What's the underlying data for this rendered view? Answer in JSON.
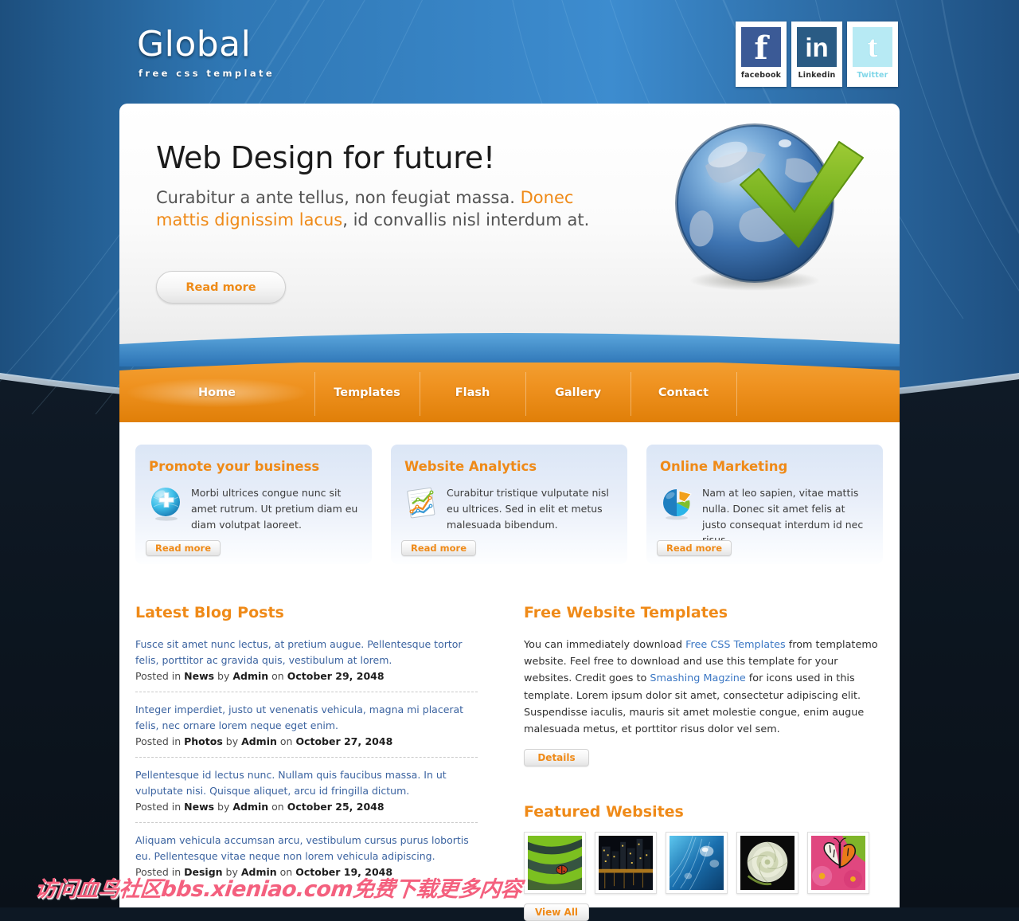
{
  "header": {
    "logo_title": "Global",
    "logo_tagline": "free css template",
    "social": [
      {
        "name": "facebook",
        "caption": "facebook",
        "glyph": "f",
        "bg": "#3b5a96"
      },
      {
        "name": "linkedin",
        "caption": "Linkedin",
        "glyph": "in",
        "bg": "#2a5b84"
      },
      {
        "name": "twitter",
        "caption": "Twitter",
        "glyph": "t",
        "bg": "#b7eaf4"
      }
    ]
  },
  "hero": {
    "title": "Web Design for future!",
    "sub_before": "Curabitur a ante tellus, non feugiat massa. ",
    "sub_highlight": "Donec mattis dignissim lacus",
    "sub_after": ", id convallis nisl interdum at.",
    "button": "Read more",
    "image": "globe-checkmark-icon"
  },
  "nav": {
    "items": [
      {
        "label": "Home",
        "active": true
      },
      {
        "label": "Templates",
        "active": false
      },
      {
        "label": "Flash",
        "active": false
      },
      {
        "label": "Gallery",
        "active": false
      },
      {
        "label": "Contact",
        "active": false
      }
    ]
  },
  "features": [
    {
      "title": "Promote your business",
      "text": "Morbi ultrices congue nunc sit amet rutrum. Ut pretium diam eu diam volutpat laoreet.",
      "button": "Read more",
      "icon": "globe-plus-icon"
    },
    {
      "title": "Website Analytics",
      "text": "Curabitur tristique vulputate nisl eu ultrices. Sed in elit et metus malesuada bibendum.",
      "button": "Read more",
      "icon": "line-chart-icon"
    },
    {
      "title": "Online Marketing",
      "text": "Nam at leo sapien, vitae mattis nulla. Donec sit amet felis at justo consequat interdum id nec risus.",
      "button": "Read more",
      "icon": "pie-chart-icon"
    }
  ],
  "blog": {
    "title": "Latest Blog Posts",
    "posts": [
      {
        "text": "Fusce sit amet nunc lectus, at pretium augue. Pellentesque tortor felis, porttitor ac gravida quis, vestibulum at lorem.",
        "meta_prefix": "Posted in ",
        "category": "News",
        "meta_by": " by ",
        "author": "Admin",
        "meta_on": " on ",
        "date": "October 29, 2048"
      },
      {
        "text": "Integer imperdiet, justo ut venenatis vehicula, magna mi placerat felis, nec ornare lorem neque eget enim.",
        "meta_prefix": "Posted in ",
        "category": "Photos",
        "meta_by": " by ",
        "author": "Admin",
        "meta_on": " on ",
        "date": "October 27, 2048"
      },
      {
        "text": "Pellentesque id lectus nunc. Nullam quis faucibus massa. In ut vulputate nisi. Quisque aliquet, arcu id fringilla dictum.",
        "meta_prefix": "Posted in ",
        "category": "News",
        "meta_by": " by ",
        "author": "Admin",
        "meta_on": " on ",
        "date": "October 25, 2048"
      },
      {
        "text": "Aliquam vehicula accumsan arcu, vestibulum cursus purus lobortis eu. Pellentesque vitae neque non lorem vehicula adipiscing.",
        "meta_prefix": "Posted in ",
        "category": "Design",
        "meta_by": " by ",
        "author": "Admin",
        "meta_on": " on ",
        "date": "October 19, 2048"
      }
    ]
  },
  "templates": {
    "title": "Free Website Templates",
    "p1": "You can immediately download ",
    "link1": "Free CSS Templates",
    "p2": " from templatemo website. Feel free to download and use this template for your websites. Credit goes to ",
    "link2": "Smashing Magzine",
    "p3": " for icons used in this template. Lorem ipsum dolor sit amet, consectetur adipiscing elit. Suspendisse iaculis, mauris sit amet molestie congue, enim augue malesuada metus, et porttitor risus dolor vel sem.",
    "button": "Details"
  },
  "featured": {
    "title": "Featured Websites",
    "button": "View All",
    "thumbs": [
      {
        "name": "green-leaf-ladybug-thumb"
      },
      {
        "name": "night-city-skyline-thumb"
      },
      {
        "name": "blue-water-drops-thumb"
      },
      {
        "name": "white-rose-thumb"
      },
      {
        "name": "butterfly-pink-flower-thumb"
      }
    ]
  },
  "watermark": {
    "text": "访问血鸟社区bbs.xieniao.com免费下载更多内容"
  },
  "colors": {
    "accent_orange": "#ef8a18",
    "link_blue": "#3b63a0",
    "nav_orange": "#ef8f17",
    "bg_dark": "#0d1824",
    "bg_blue": "#2f7fc4"
  }
}
